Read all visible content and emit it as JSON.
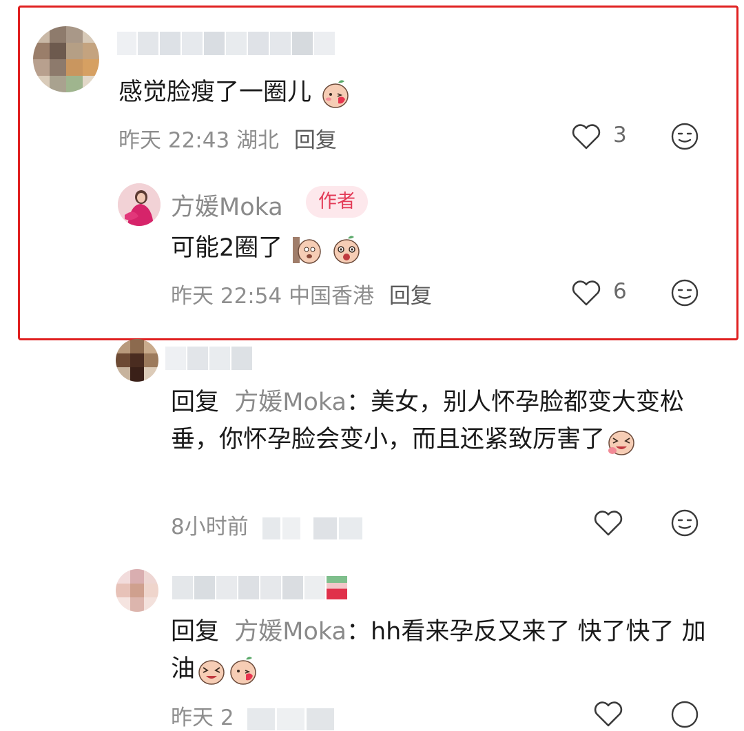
{
  "comments": [
    {
      "text": "感觉脸瘦了一圈儿",
      "time": "昨天 22:43",
      "location": "湖北",
      "reply_label": "回复",
      "likes": "3"
    }
  ],
  "author_reply": {
    "name": "方媛Moka",
    "badge": "作者",
    "text": "可能2圈了",
    "time": "昨天 22:54",
    "location": "中国香港",
    "reply_label": "回复",
    "likes": "6"
  },
  "sub_replies": [
    {
      "prefix": "回复",
      "target": "方媛Moka",
      "body": "：美女，别人怀孕脸都变大变松垂，你怀孕脸会变小，而且还紧致厉害了",
      "time": "8小时前"
    },
    {
      "prefix": "回复",
      "target": "方媛Moka",
      "body": "：hh看来孕反又来了 快了快了 加油",
      "time": "昨天 2"
    }
  ],
  "colors": {
    "highlight": "#e02020",
    "badge_bg": "#fde8ec",
    "badge_text": "#e33b57",
    "meta": "#8e8e8e"
  },
  "icons": [
    "heart-outline-icon",
    "emoji-face-icon"
  ]
}
